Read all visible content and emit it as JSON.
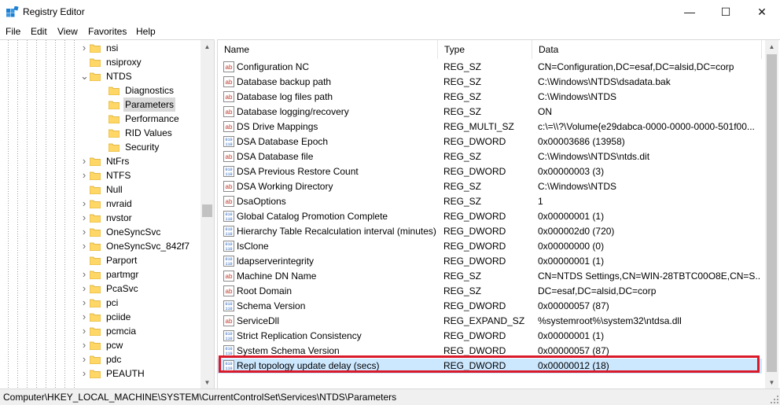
{
  "window": {
    "title": "Registry Editor",
    "minimize_glyph": "—",
    "maximize_glyph": "☐",
    "close_glyph": "✕"
  },
  "menu": [
    "File",
    "Edit",
    "View",
    "Favorites",
    "Help"
  ],
  "tree": {
    "items": [
      {
        "label": "nsi",
        "level": 1,
        "arrow": "right"
      },
      {
        "label": "nsiproxy",
        "level": 1,
        "arrow": "none"
      },
      {
        "label": "NTDS",
        "level": 1,
        "arrow": "down"
      },
      {
        "label": "Diagnostics",
        "level": 2,
        "arrow": "none"
      },
      {
        "label": "Parameters",
        "level": 2,
        "arrow": "none",
        "selected": true
      },
      {
        "label": "Performance",
        "level": 2,
        "arrow": "none"
      },
      {
        "label": "RID Values",
        "level": 2,
        "arrow": "none"
      },
      {
        "label": "Security",
        "level": 2,
        "arrow": "none"
      },
      {
        "label": "NtFrs",
        "level": 1,
        "arrow": "right"
      },
      {
        "label": "NTFS",
        "level": 1,
        "arrow": "right"
      },
      {
        "label": "Null",
        "level": 1,
        "arrow": "none"
      },
      {
        "label": "nvraid",
        "level": 1,
        "arrow": "right"
      },
      {
        "label": "nvstor",
        "level": 1,
        "arrow": "right"
      },
      {
        "label": "OneSyncSvc",
        "level": 1,
        "arrow": "right"
      },
      {
        "label": "OneSyncSvc_842f7",
        "level": 1,
        "arrow": "right"
      },
      {
        "label": "Parport",
        "level": 1,
        "arrow": "none"
      },
      {
        "label": "partmgr",
        "level": 1,
        "arrow": "right"
      },
      {
        "label": "PcaSvc",
        "level": 1,
        "arrow": "right"
      },
      {
        "label": "pci",
        "level": 1,
        "arrow": "right"
      },
      {
        "label": "pciide",
        "level": 1,
        "arrow": "right"
      },
      {
        "label": "pcmcia",
        "level": 1,
        "arrow": "right"
      },
      {
        "label": "pcw",
        "level": 1,
        "arrow": "right"
      },
      {
        "label": "pdc",
        "level": 1,
        "arrow": "right"
      },
      {
        "label": "PEAUTH",
        "level": 1,
        "arrow": "right"
      }
    ]
  },
  "list": {
    "columns": [
      "Name",
      "Type",
      "Data"
    ],
    "rows": [
      {
        "name": "Configuration NC",
        "type": "REG_SZ",
        "data": "CN=Configuration,DC=esaf,DC=alsid,DC=corp",
        "icon": "string"
      },
      {
        "name": "Database backup path",
        "type": "REG_SZ",
        "data": "C:\\Windows\\NTDS\\dsadata.bak",
        "icon": "string"
      },
      {
        "name": "Database log files path",
        "type": "REG_SZ",
        "data": "C:\\Windows\\NTDS",
        "icon": "string"
      },
      {
        "name": "Database logging/recovery",
        "type": "REG_SZ",
        "data": "ON",
        "icon": "string"
      },
      {
        "name": "DS Drive Mappings",
        "type": "REG_MULTI_SZ",
        "data": "c:\\=\\\\?\\Volume{e29dabca-0000-0000-0000-501f00...",
        "icon": "string"
      },
      {
        "name": "DSA Database Epoch",
        "type": "REG_DWORD",
        "data": "0x00003686 (13958)",
        "icon": "binary"
      },
      {
        "name": "DSA Database file",
        "type": "REG_SZ",
        "data": "C:\\Windows\\NTDS\\ntds.dit",
        "icon": "string"
      },
      {
        "name": "DSA Previous Restore Count",
        "type": "REG_DWORD",
        "data": "0x00000003 (3)",
        "icon": "binary"
      },
      {
        "name": "DSA Working Directory",
        "type": "REG_SZ",
        "data": "C:\\Windows\\NTDS",
        "icon": "string"
      },
      {
        "name": "DsaOptions",
        "type": "REG_SZ",
        "data": "1",
        "icon": "string"
      },
      {
        "name": "Global Catalog Promotion Complete",
        "type": "REG_DWORD",
        "data": "0x00000001 (1)",
        "icon": "binary"
      },
      {
        "name": "Hierarchy Table Recalculation interval (minutes)",
        "type": "REG_DWORD",
        "data": "0x000002d0 (720)",
        "icon": "binary"
      },
      {
        "name": "IsClone",
        "type": "REG_DWORD",
        "data": "0x00000000 (0)",
        "icon": "binary"
      },
      {
        "name": "ldapserverintegrity",
        "type": "REG_DWORD",
        "data": "0x00000001 (1)",
        "icon": "binary"
      },
      {
        "name": "Machine DN Name",
        "type": "REG_SZ",
        "data": "CN=NTDS Settings,CN=WIN-28TBTC00O8E,CN=S...",
        "icon": "string"
      },
      {
        "name": "Root Domain",
        "type": "REG_SZ",
        "data": "DC=esaf,DC=alsid,DC=corp",
        "icon": "string"
      },
      {
        "name": "Schema Version",
        "type": "REG_DWORD",
        "data": "0x00000057 (87)",
        "icon": "binary"
      },
      {
        "name": "ServiceDll",
        "type": "REG_EXPAND_SZ",
        "data": "%systemroot%\\system32\\ntdsa.dll",
        "icon": "string"
      },
      {
        "name": "Strict Replication Consistency",
        "type": "REG_DWORD",
        "data": "0x00000001 (1)",
        "icon": "binary"
      },
      {
        "name": "System Schema Version",
        "type": "REG_DWORD",
        "data": "0x00000057 (87)",
        "icon": "binary"
      },
      {
        "name": "Repl topology update delay (secs)",
        "type": "REG_DWORD",
        "data": "0x00000012 (18)",
        "icon": "binary",
        "selected": true
      }
    ]
  },
  "status": {
    "path": "Computer\\HKEY_LOCAL_MACHINE\\SYSTEM\\CurrentControlSet\\Services\\NTDS\\Parameters"
  },
  "colors": {
    "selection": "#cce8ff",
    "highlight": "#d91a2a",
    "folder": "#ffd766"
  }
}
